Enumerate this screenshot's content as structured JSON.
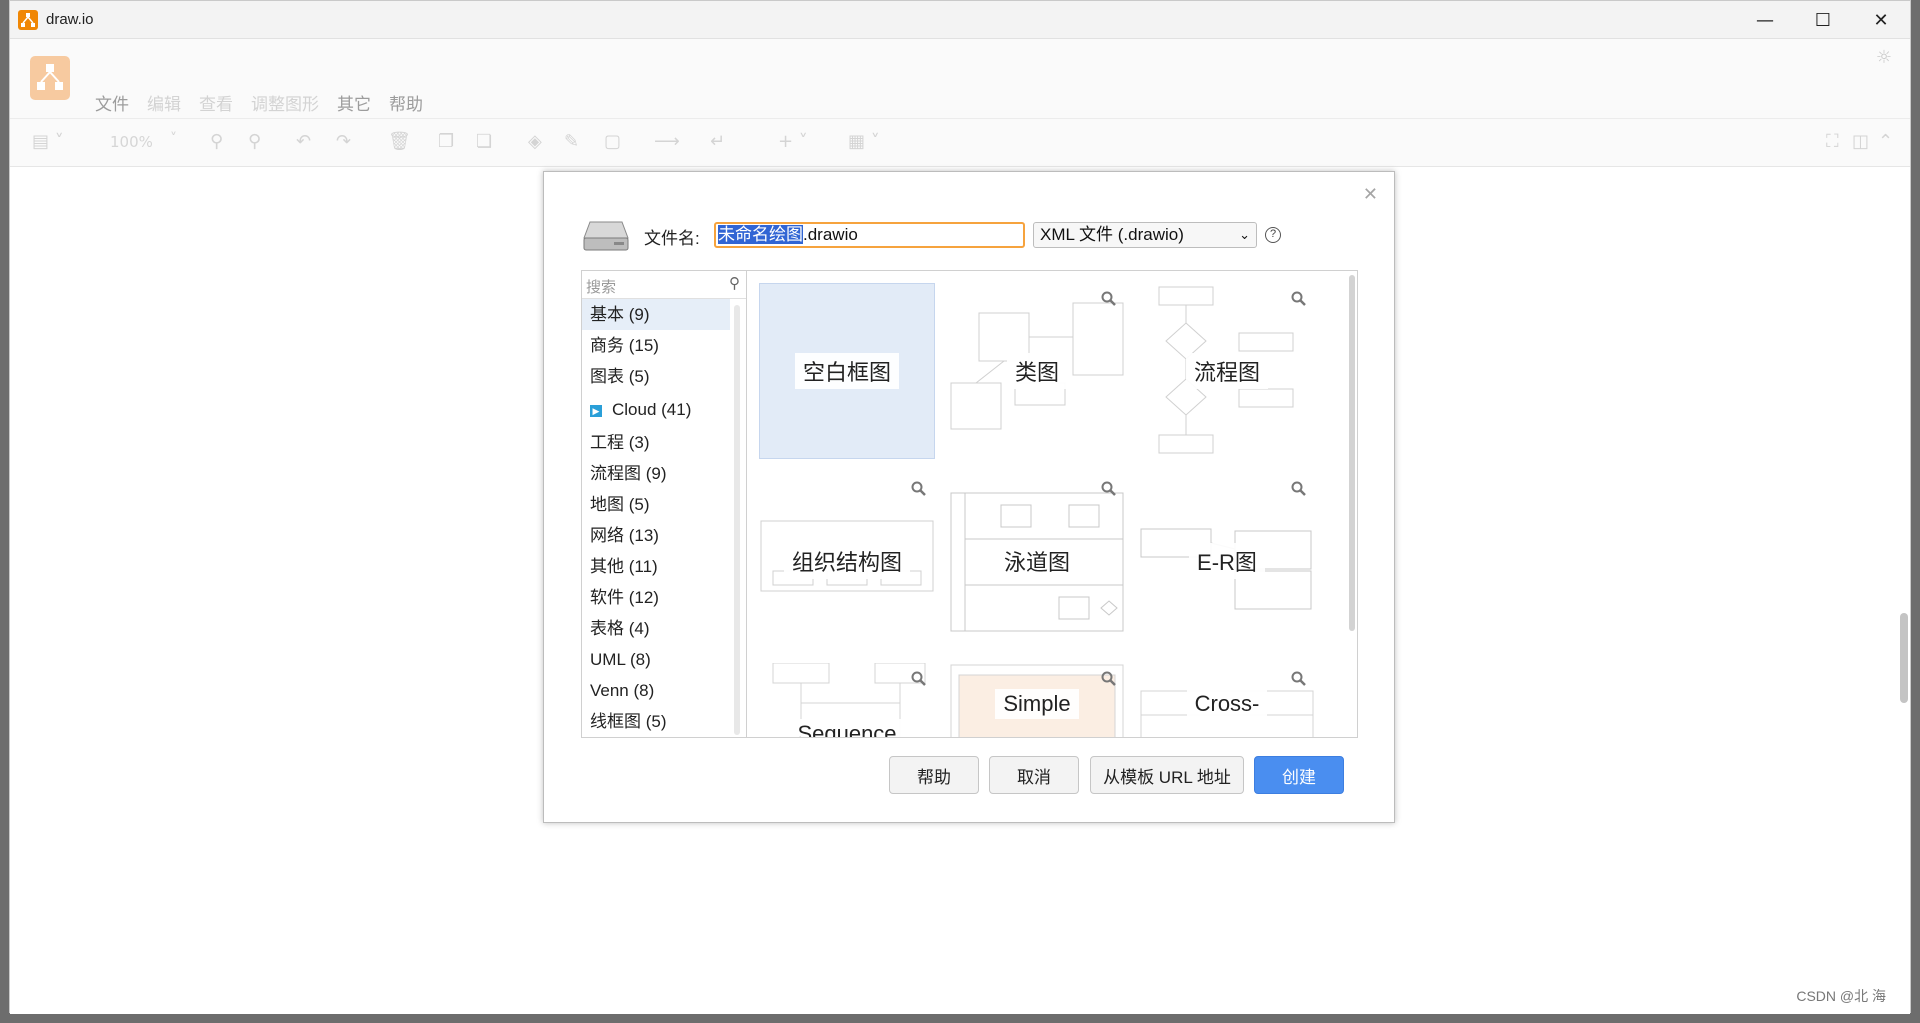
{
  "window": {
    "title": "draw.io"
  },
  "menubar": {
    "items": [
      {
        "label": "文件",
        "faded": false
      },
      {
        "label": "编辑",
        "faded": true
      },
      {
        "label": "查看",
        "faded": true
      },
      {
        "label": "调整图形",
        "faded": true
      },
      {
        "label": "其它",
        "faded": false
      },
      {
        "label": "帮助",
        "faded": false
      }
    ]
  },
  "toolbar": {
    "zoom": "100%"
  },
  "dialog": {
    "filename_label": "文件名:",
    "filename_selected": "未命名绘图",
    "filename_rest": ".drawio",
    "format_value": "XML 文件 (.drawio)",
    "help_glyph": "?",
    "search_placeholder": "搜索",
    "categories": [
      {
        "label": "基本 (9)",
        "active": true
      },
      {
        "label": "商务 (15)"
      },
      {
        "label": "图表 (5)"
      },
      {
        "label": "Cloud (41)",
        "expandable": true
      },
      {
        "label": "工程 (3)"
      },
      {
        "label": "流程图 (9)"
      },
      {
        "label": "地图 (5)"
      },
      {
        "label": "网络 (13)"
      },
      {
        "label": "其他 (11)"
      },
      {
        "label": "软件 (12)"
      },
      {
        "label": "表格 (4)"
      },
      {
        "label": "UML (8)"
      },
      {
        "label": "Venn (8)"
      },
      {
        "label": "线框图 (5)"
      }
    ],
    "templates": [
      {
        "label": "空白框图"
      },
      {
        "label": "类图"
      },
      {
        "label": "流程图"
      },
      {
        "label": "组织结构图"
      },
      {
        "label": "泳道图"
      },
      {
        "label": "E-R图"
      },
      {
        "label": "Sequence"
      },
      {
        "label": "Simple"
      },
      {
        "label": "Cross-"
      }
    ],
    "buttons": {
      "help": "帮助",
      "cancel": "取消",
      "from_url": "从模板 URL 地址",
      "create": "创建"
    }
  },
  "watermark": "CSDN @北 海",
  "colors": {
    "accent": "#4a8ef0",
    "input_border": "#f6a33e",
    "selection": "#3165d4",
    "brand": "#f08705"
  }
}
